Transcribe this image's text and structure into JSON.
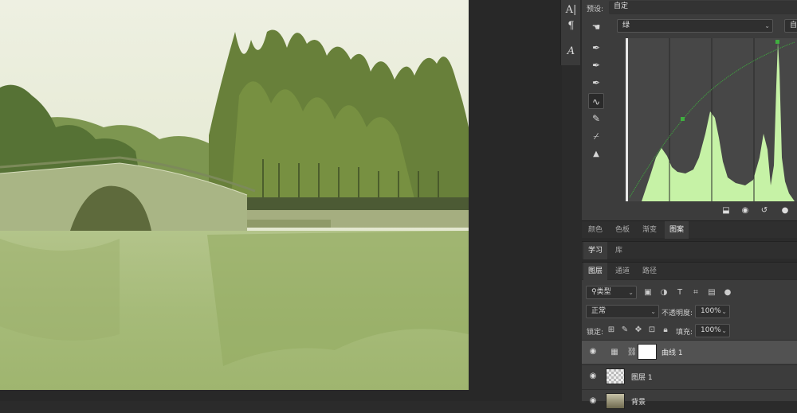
{
  "tools": [
    {
      "icon": "text-vertical-icon",
      "glyph": "A|"
    },
    {
      "icon": "paragraph-icon",
      "glyph": "¶"
    },
    {
      "icon": "character-style-icon",
      "glyph": "A"
    }
  ],
  "properties": {
    "preset_label": "预设:",
    "preset_value": "自定",
    "channel_value": "绿",
    "auto_label": "自动",
    "curve_tools": [
      "hand-adjust-icon",
      "eyedropper-black-icon",
      "eyedropper-gray-icon",
      "eyedropper-white-icon",
      "curve-point-icon",
      "pencil-icon",
      "smooth-icon",
      "clip-warning-icon"
    ],
    "bottom_icons": [
      "clip-to-layer-icon",
      "view-previous-icon",
      "reset-icon",
      "visibility-icon"
    ]
  },
  "panel_tabs": [
    "颜色",
    "色板",
    "渐变",
    "图案"
  ],
  "learn_tabs": [
    "学习",
    "库"
  ],
  "layer_tabs": [
    "图层",
    "通道",
    "路径"
  ],
  "layers_panel": {
    "filter_label": "类型",
    "blend_mode": "正常",
    "opacity_label": "不透明度:",
    "opacity_value": "100%",
    "lock_label": "锁定:",
    "fill_label": "填充:",
    "fill_value": "100%",
    "layers": [
      {
        "name": "曲线 1",
        "selected": true
      },
      {
        "name": "图层 1",
        "selected": false
      },
      {
        "name": "背景",
        "selected": false
      }
    ]
  },
  "colors": {
    "panel_bg": "#3c3c3c",
    "histogram": "#c6f2a6",
    "curve": "#3fae3f"
  }
}
